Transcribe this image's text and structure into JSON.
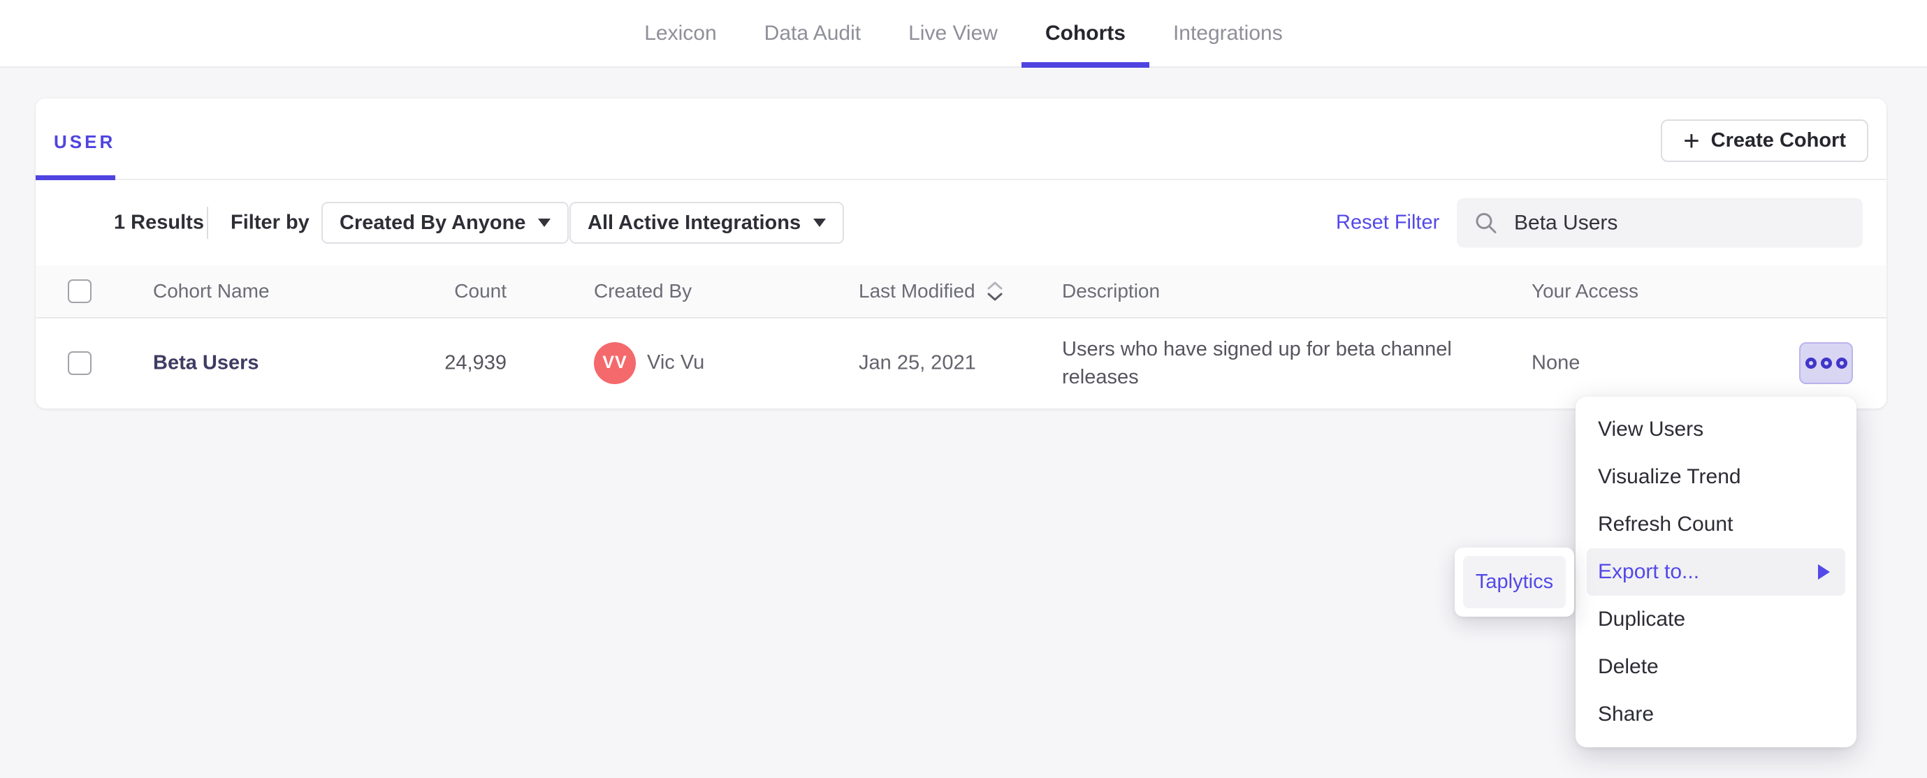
{
  "nav": {
    "active_tab": "Cohorts",
    "tabs": [
      {
        "label": "Lexicon"
      },
      {
        "label": "Data Audit"
      },
      {
        "label": "Live View"
      },
      {
        "label": "Cohorts"
      },
      {
        "label": "Integrations"
      }
    ]
  },
  "card": {
    "tab_label": "USER",
    "create_button": {
      "plus": "+",
      "label": "Create Cohort"
    },
    "filters": {
      "results_count": "1 Results",
      "filter_by_label": "Filter by",
      "created_by_dropdown": "Created By Anyone",
      "integrations_dropdown": "All Active Integrations",
      "reset_filter": "Reset Filter",
      "search": {
        "value": "Beta Users"
      }
    },
    "table": {
      "headers": {
        "name": "Cohort Name",
        "count": "Count",
        "created_by": "Created By",
        "last_modified": "Last Modified",
        "description": "Description",
        "access": "Your Access"
      },
      "row": {
        "name": "Beta Users",
        "count": "24,939",
        "creator_initials": "VV",
        "creator_name": "Vic Vu",
        "last_modified": "Jan 25, 2021",
        "description": "Users who have signed up for beta channel releases",
        "access": "None"
      }
    }
  },
  "context_menu": {
    "highlighted_item": "Export to...",
    "items": [
      {
        "label": "View Users"
      },
      {
        "label": "Visualize Trend"
      },
      {
        "label": "Refresh Count"
      },
      {
        "label": "Export to..."
      },
      {
        "label": "Duplicate"
      },
      {
        "label": "Delete"
      },
      {
        "label": "Share"
      }
    ],
    "submenu": {
      "items": [
        {
          "label": "Taplytics"
        }
      ]
    }
  },
  "icons": {
    "plus": "plus-icon",
    "caret": "chevron-down-icon",
    "sort": "sort-updown-icon",
    "search": "search-icon",
    "more": "three-circles-icon",
    "submenu_arrow": "arrow-right-icon"
  },
  "colors": {
    "accent_purple": "#4f44e0",
    "link_purple": "#5348e8",
    "avatar_red": "#f4696b",
    "cohort_name_navy": "#3e3b63",
    "page_bg": "#f6f6f8"
  }
}
